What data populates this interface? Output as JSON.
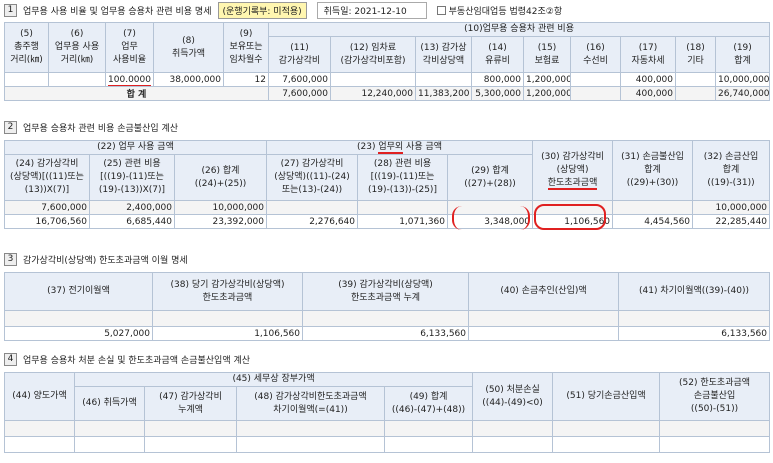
{
  "section1": {
    "num": "1",
    "title": "업무용 사용 비율 및 업무용 승용차 관련 비용 명세",
    "badge": "(운행기록부: 미적용)",
    "acq_label": "취득일: 2021-12-10",
    "checkbox_label": "부동산임대업등 법령42조②항",
    "headers": {
      "h5": "(5)\n총주행\n거리(㎞)",
      "h6": "(6)\n업무용 사용\n거리(㎞)",
      "h7": "(7)\n업무\n사용비율",
      "h8": "(8)\n취득가액",
      "h9": "(9)\n보유또는\n임차월수",
      "h10": "(10)업무용 승용차 관련 비용",
      "h11": "(11)\n감가상각비",
      "h12": "(12) 임차료\n(감가상각비포함)",
      "h13": "(13) 감가상\n각비상당액",
      "h14": "(14)\n유류비",
      "h15": "(15)\n보험료",
      "h16": "(16)\n수선비",
      "h17": "(17)\n자동차세",
      "h18": "(18)\n기타",
      "h19": "(19)\n합계"
    },
    "row": [
      "",
      "",
      "100.0000",
      "38,000,000",
      "12",
      "7,600,000",
      "",
      "",
      "800,000",
      "1,200,000",
      "",
      "400,000",
      "",
      "10,000,000"
    ],
    "total_label": "합   계",
    "total": [
      "7,600,000",
      "12,240,000",
      "11,383,200",
      "5,300,000",
      "1,200,000",
      "",
      "400,000",
      "",
      "26,740,000"
    ]
  },
  "section2": {
    "num": "2",
    "title": "업무용 승용차 관련 비용 손금불산입 계산",
    "headers": {
      "h22": "(22) 업무 사용 금액",
      "h23_pre": "(23) ",
      "h23_u": "업무외",
      "h23_post": " 사용 금액",
      "h24": "(24) 감가상각비\n(상당액)[((11)또는\n(13))X(7)]",
      "h25": "(25) 관련 비용\n[((19)-(11)또는\n(19)-(13))X(7)]",
      "h26": "(26) 합계\n((24)+(25))",
      "h27": "(27) 감가상각비\n(상당액)((11)-(24)\n또는(13)-(24))",
      "h28": "(28) 관련 비용\n[((19)-(11)또는\n(19)-(13))-(25)]",
      "h29": "(29) 합계\n((27)+(28))",
      "h30_a": "(30) 감가상각비",
      "h30_b": "(상당액)",
      "h30_c": "한도초과금액",
      "h31": "(31) 손금불산입\n합계\n((29)+(30))",
      "h32": "(32) 손금산입\n합계\n((19)-(31))"
    },
    "row1": [
      "7,600,000",
      "2,400,000",
      "10,000,000",
      "",
      "",
      "",
      "",
      "",
      "10,000,000"
    ],
    "row2": [
      "16,706,560",
      "6,685,440",
      "23,392,000",
      "2,276,640",
      "1,071,360",
      "3,348,000",
      "1,106,560",
      "4,454,560",
      "22,285,440"
    ]
  },
  "section3": {
    "num": "3",
    "title": "감가상각비(상당액) 한도초과금액 이월 명세",
    "headers": {
      "h37": "(37) 전기이월액",
      "h38": "(38) 당기 감가상각비(상당액)\n한도초과금액",
      "h39": "(39) 감가상각비(상당액)\n한도초과금액 누계",
      "h40": "(40) 손금추인(산입)액",
      "h41": "(41) 차기이월액((39)-(40))"
    },
    "row2": [
      "5,027,000",
      "1,106,560",
      "6,133,560",
      "",
      "6,133,560"
    ]
  },
  "section4": {
    "num": "4",
    "title": "업무용 승용차 처분 손실 및 한도초과금액 손금불산입액 계산",
    "headers": {
      "h44": "(44) 양도가액",
      "h45": "(45) 세무상 장부가액",
      "h46": "(46) 취득가액",
      "h47": "(47) 감가상각비\n누계액",
      "h48": "(48) 감가상각비한도초과금액\n차기이월액(=(41))",
      "h49": "(49) 합계\n((46)-(47)+(48))",
      "h50": "(50) 처분손실\n((44)-(49)<0)",
      "h51": "(51) 당기손금산입액",
      "h52": "(52) 한도초과금액\n손금불산입\n((50)-(51))"
    }
  }
}
